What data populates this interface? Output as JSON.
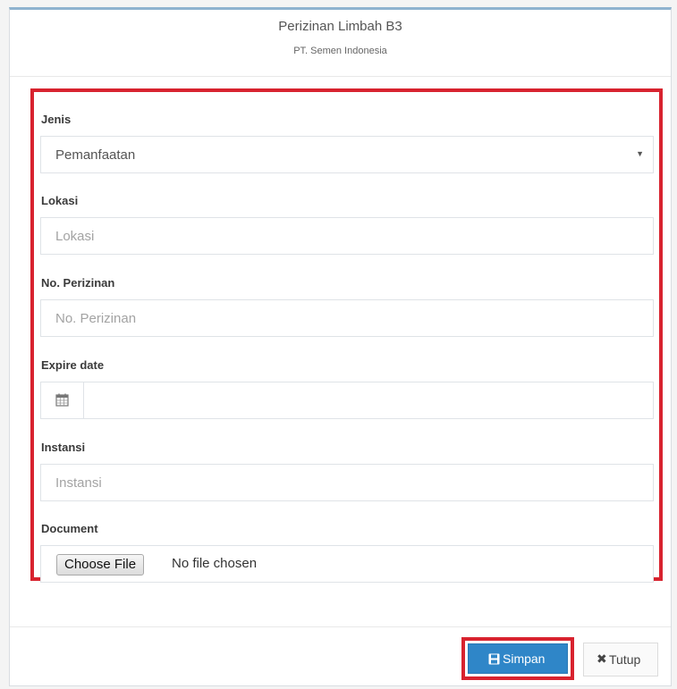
{
  "header": {
    "title": "Perizinan Limbah B3",
    "subtitle": "PT. Semen Indonesia"
  },
  "form": {
    "jenis": {
      "label": "Jenis",
      "value": "Pemanfaatan"
    },
    "lokasi": {
      "label": "Lokasi",
      "placeholder": "Lokasi"
    },
    "no_perizinan": {
      "label": "No. Perizinan",
      "placeholder": "No. Perizinan"
    },
    "expire_date": {
      "label": "Expire date",
      "value": ""
    },
    "instansi": {
      "label": "Instansi",
      "placeholder": "Instansi"
    },
    "document": {
      "label": "Document",
      "button_label": "Choose File",
      "status": "No file chosen"
    }
  },
  "footer": {
    "save_label": "Simpan",
    "close_label": "Tutup"
  },
  "icons": {
    "select_caret": "chevron-down-icon",
    "calendar": "calendar-icon",
    "save": "floppy-disk-icon",
    "close": "close-icon"
  },
  "colors": {
    "highlight": "#d8232f",
    "primary_button": "#2f86c8"
  }
}
